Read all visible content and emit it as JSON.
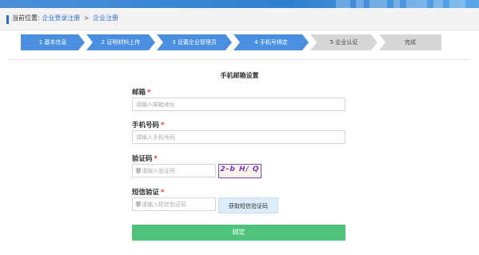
{
  "breadcrumb": {
    "label": "当前位置:",
    "items": [
      "企业登录注册",
      "企业注册"
    ],
    "separator": ">"
  },
  "steps": [
    {
      "label": "1 基本信息",
      "state": "done"
    },
    {
      "label": "2 证明材料上传",
      "state": "done"
    },
    {
      "label": "3 设置企业管理员",
      "state": "done"
    },
    {
      "label": "4 手机号绑定",
      "state": "current"
    },
    {
      "label": "5 企业认证",
      "state": "pending"
    },
    {
      "label": "完成",
      "state": "pending"
    }
  ],
  "form": {
    "title": "手机邮箱设置",
    "required_mark": "*",
    "email": {
      "label": "邮箱",
      "placeholder": "请输入邮箱地址"
    },
    "phone": {
      "label": "手机号码",
      "placeholder": "请输入手机号码"
    },
    "captcha": {
      "label": "验证码",
      "placeholder": "请输入验证码",
      "image_text": "2-b H/ Q"
    },
    "sms": {
      "label": "短信验证",
      "placeholder": "请输入短信验证码",
      "button": "获取短信验证码"
    },
    "submit": "绑定"
  },
  "colors": {
    "active_step": "#4a8fe0",
    "inactive_step": "#d6d6d6",
    "submit": "#4fc27c",
    "required": "#e0302a",
    "link": "#2e6fc9"
  }
}
